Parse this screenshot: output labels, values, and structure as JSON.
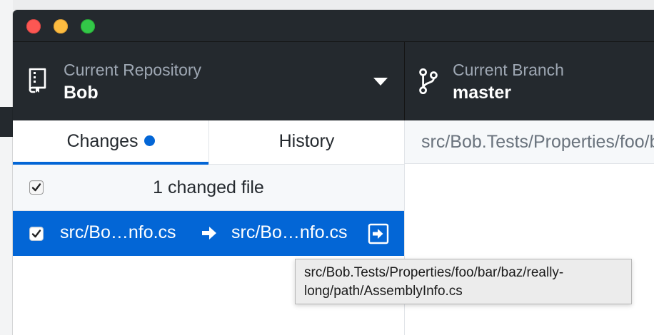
{
  "window": {
    "traffic_lights": {
      "close": "#fc5753",
      "minimize": "#fdbc40",
      "maximize": "#33c748"
    }
  },
  "toolbar": {
    "repository": {
      "label": "Current Repository",
      "value": "Bob",
      "icon": "repo-icon",
      "dropdown_icon": "triangle-down-icon"
    },
    "branch": {
      "label": "Current Branch",
      "value": "master",
      "icon": "git-branch-icon"
    }
  },
  "tabs": [
    {
      "label": "Changes",
      "selected": true,
      "has_changes_indicator": true
    },
    {
      "label": "History",
      "selected": false
    }
  ],
  "changes": {
    "summary": "1 changed file",
    "all_checked": true,
    "files": [
      {
        "checked": true,
        "old_path": "src/Bo…nfo.cs",
        "new_path": "src/Bo…nfo.cs",
        "rename_arrow_icon": "arrow-right-icon",
        "status_icon": "renamed-icon",
        "selected": true
      }
    ]
  },
  "diff": {
    "header_path": "src/Bob.Tests/Properties/foo/bar/baz/really-long/path/AssemblyInfo.cs"
  },
  "tooltip": {
    "line1": "src/Bob.Tests/Properties/foo/bar/baz/really-",
    "line2": "long/path/AssemblyInfo.cs"
  },
  "colors": {
    "toolbar_bg": "#24292e",
    "accent": "#0366d6",
    "muted_text": "#9ea7b3",
    "tooltip_bg": "#ececec"
  }
}
